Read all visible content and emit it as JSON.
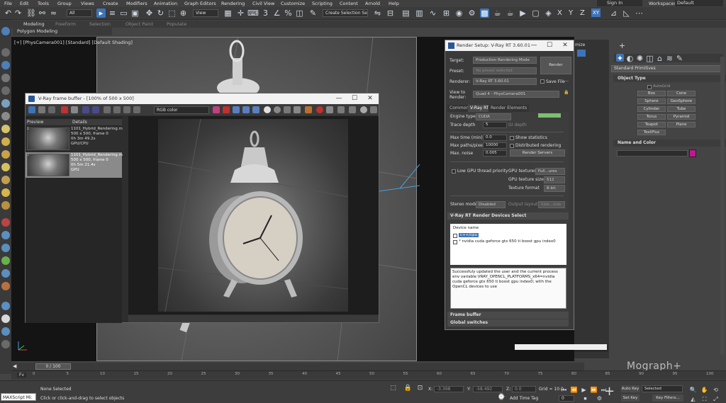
{
  "menu": {
    "items": [
      "File",
      "Edit",
      "Tools",
      "Group",
      "Views",
      "Create",
      "Modifiers",
      "Animation",
      "Graph Editors",
      "Rendering",
      "Civil View",
      "Customize",
      "Scripting",
      "Content",
      "Arnold",
      "Help"
    ],
    "sign_in": "Sign In",
    "workspaces_label": "Workspaces:",
    "workspaces_value": "Default"
  },
  "toolbar": {
    "filter_select": "All",
    "view_select": "View",
    "selection_set": "Create Selection Se",
    "axis_x": "X",
    "axis_y": "Y",
    "axis_z": "Z",
    "axis_xy": "XY"
  },
  "ribbon": {
    "tabs": [
      "Modeling",
      "Freeform",
      "Selection",
      "Object Paint",
      "Populate"
    ],
    "active_tab": "Modeling",
    "sub_label": "Polygon Modeling"
  },
  "viewport": {
    "label": "[+] [PhysCamera001] [Standard] [Default Shading]"
  },
  "frame_buffer": {
    "title": "V-Ray frame buffer - [100% of 500 x 500]",
    "channel": "RGB color",
    "history_headers": [
      "Preview",
      "Details"
    ],
    "history": [
      {
        "index": "1",
        "lines": [
          "1101_Hybrid_Rendering.m",
          "500 x 500, frame 0",
          "0h 3m 49.2s",
          "GPU/CPU"
        ]
      },
      {
        "index": "2",
        "lines": [
          "1101_Hybrid_Rendering.m",
          "500 x 500, frame 0",
          "0h 5m 21.4s",
          "GPU"
        ]
      }
    ]
  },
  "render_setup": {
    "title": "Render Setup: V-Ray RT 3.60.01",
    "target_label": "Target:",
    "target_value": "Production Rendering Mode",
    "preset_label": "Preset:",
    "preset_value": "No preset selected",
    "renderer_label": "Renderer:",
    "renderer_value": "V-Ray RT 3.60.01",
    "save_file": "Save File",
    "render_button": "Render",
    "view_label": "View to Render:",
    "view_value": "Quad 4 - PhysCamera001",
    "tabs": [
      "Common",
      "V-Ray RT",
      "Render Elements"
    ],
    "active_tab": "V-Ray RT",
    "engine_label": "Engine type",
    "engine_value": "CUDA",
    "trace_depth_label": "Trace depth",
    "trace_depth_value": "5",
    "gi_depth_label": "GI depth",
    "max_time_label": "Max time (min)",
    "max_time_value": "0.0",
    "max_paths_label": "Max paths/pixel",
    "max_paths_value": "10000",
    "max_noise_label": "Max. noise",
    "max_noise_value": "0.005",
    "show_statistics": "Show statistics",
    "distributed_rendering": "Distributed rendering",
    "render_servers": "Render Servers",
    "low_gpu": "Low GPU thread priority",
    "gpu_textures_label": "GPU textures",
    "gpu_textures_value": "Full...ures",
    "gpu_tex_size_label": "GPU texture size",
    "gpu_tex_size_value": "512",
    "tex_format_label": "Texture format",
    "tex_format_value": "8-bit",
    "stereo_label": "Stereo mode",
    "stereo_value": "Disabled",
    "output_layout_label": "Output layout",
    "output_layout_value": "Side...side",
    "devices_section": "V-Ray RT Render Devices Select",
    "device_col": "Device name",
    "devices": [
      "c++/cpu",
      "* nvidia cuda geforce gtx 650 ti boost gpu index0"
    ],
    "log_text": "Successfuly updated the user  and the current process env variable VRAY_OPENCL_PLATFORMS_x64=nvidia cuda geforce gtx 650 ti boost gpu index0; with the OpenCL devices to use",
    "frame_buffer_section": "Frame buffer",
    "global_switches_section": "Global switches"
  },
  "command_panel": {
    "category": "Standard Primitives",
    "object_type_header": "Object Type",
    "autogrid": "AutoGrid",
    "buttons": [
      "Box",
      "Cone",
      "Sphere",
      "GeoSphere",
      "Cylinder",
      "Tube",
      "Torus",
      "Pyramid",
      "Teapot",
      "Plane",
      "TextPlus"
    ],
    "name_color_header": "Name and Color",
    "default_label": "Default",
    "optimize_partial": "mize",
    "color_swatch": "#c0188f"
  },
  "timeline": {
    "frame_counter": "0 / 100",
    "ticks": [
      "0",
      "5",
      "10",
      "15",
      "20",
      "25",
      "30",
      "35",
      "40",
      "45",
      "50",
      "55",
      "60",
      "65",
      "70",
      "75",
      "80",
      "85",
      "90",
      "95",
      "100"
    ]
  },
  "status": {
    "maxscript": "MAXScript Mi:",
    "selected": "None Selected",
    "prompt": "Click or click-and-drag to select objects",
    "x_label": "X:",
    "x_value": "-3.398",
    "y_label": "Y:",
    "y_value": "-58.492",
    "z_label": "Z:",
    "z_value": "0.0",
    "grid": "Grid = 10.0",
    "add_time_tag": "Add Time Tag",
    "auto_key": "Auto Key",
    "selected_dd": "Selected",
    "set_key": "Set Key",
    "key_filters": "Key Filters...",
    "frame_value": "0"
  },
  "watermark": "Mograph+",
  "colors": {
    "accent_blue": "#3d74b8",
    "vray_purple": "#c0188f",
    "panel_bg": "#3a3a3a"
  }
}
